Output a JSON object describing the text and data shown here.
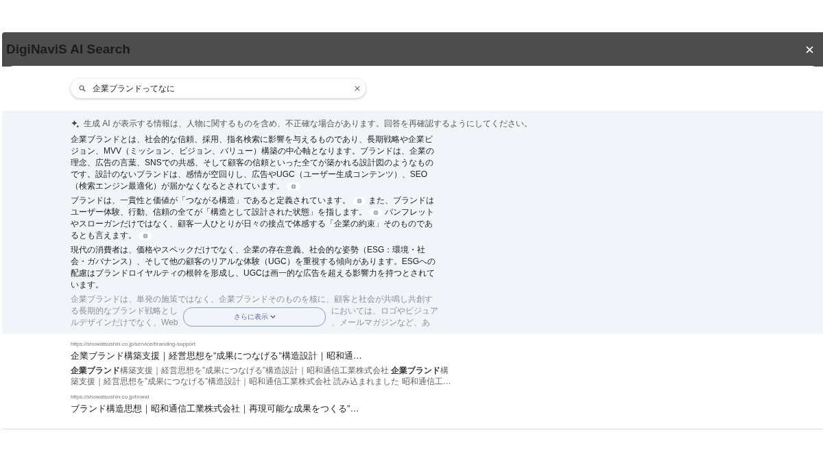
{
  "window": {
    "title": "DigiNaviS AI Search"
  },
  "search": {
    "value": "企業ブランドってなに"
  },
  "ai_notice": "生成 AI が表示する情報は、人物に関するものを含め、不正確な場合があります。回答を再確認するようにしてください。",
  "answer": {
    "paragraphs": [
      {
        "segments": [
          {
            "kind": "text",
            "text": "企業ブランドとは、社会的な信頼、採用、指名検索に影響を与えるものであり、長期戦略や企業ビジョン、MVV（ミッション、ビジョン、バリュー）構築の中心軸となります。ブランドは、企業の理念、広告の言葉、SNSでの共感、そして顧客の信頼といった全てが築かれる設計図のようなものです。設計のないブランドは、感情が空回りし、広告やUGC（ユーザー生成コンテンツ）、SEO（検索エンジン最適化）が届かなくなるとされています。"
          },
          {
            "kind": "cite"
          }
        ]
      },
      {
        "segments": [
          {
            "kind": "text",
            "text": "ブランドは、一貫性と価値が「つながる構造」であると定義されています。"
          },
          {
            "kind": "cite"
          },
          {
            "kind": "text",
            "text": "また、ブランドはユーザー体験、行動、信頼の全てが「構造として設計された状態」を指します。"
          },
          {
            "kind": "cite"
          },
          {
            "kind": "text",
            "text": "パンフレットやスローガンだけではなく、顧客一人ひとりが日々の接点で体感する「企業の約束」そのものであるとも言えます。"
          },
          {
            "kind": "cite"
          }
        ]
      },
      {
        "segments": [
          {
            "kind": "text",
            "text": "現代の消費者は、価格やスペックだけでなく、企業の存在意義、社会的な姿勢（ESG：環境・社会・ガバナンス）、そして他の顧客のリアルな体験（UGC）を重視する傾向があります。ESGへの配慮はブランドロイヤルティの根幹を形成し、UGCは画一的な広告を超える影響力を持つとされています。"
          }
        ]
      }
    ],
    "faded_lines": [
      {
        "left": "企業ブランドは、単発の施策ではなく、企業ブランドそのものを核に、顧客と社会が共鳴し共創す"
      },
      {
        "left": "る長期的なブランド戦略とし",
        "right": "においては、ロゴやビジュア"
      },
      {
        "left": "ルデザインだけでなく、Web",
        "right": "、メールマガジンなど、あ"
      }
    ],
    "more_button": "さらに表示"
  },
  "results": [
    {
      "url": "https://showatsushin.co.jp/service/branding-support",
      "title": "企業ブランド構築支援｜経営思想を”成果につなげる”構造設計｜昭和通…",
      "snippet_lines": [
        "**企業ブランド**構築支援｜経営思想を”成果につなげる”構造設計｜昭和通信工業株式会社 **企業ブランド**構",
        "築支援｜経営思想を”成果につなげる”構造設計｜昭和通信工業株式会社 読み込まれました 昭和通信工…"
      ]
    },
    {
      "url": "https://showatsushin.co.jp/brand",
      "title": "ブランド構造思想｜昭和通信工業株式会社｜再現可能な成果をつくる”…"
    }
  ]
}
